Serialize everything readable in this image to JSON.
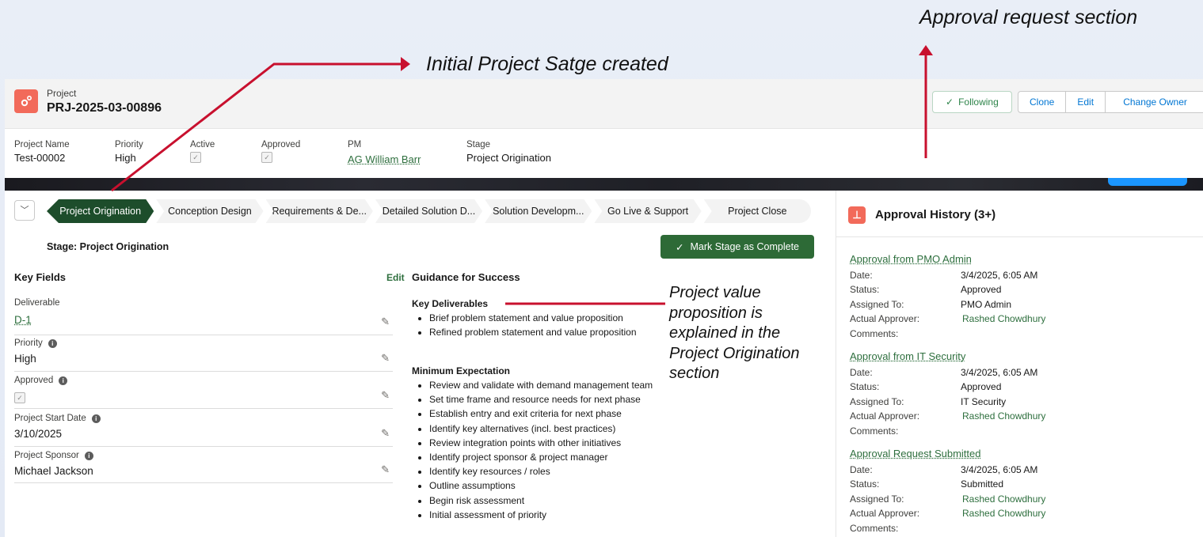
{
  "annotations": {
    "approval_request": "Approval request section",
    "initial_stage": "Initial Project Satge created",
    "value_prop": "Project value proposition is explained in the Project Origination section"
  },
  "header": {
    "object_label": "Project",
    "record_name": "PRJ-2025-03-00896",
    "actions": [
      "Following",
      "Clone",
      "Edit",
      "Change Owner"
    ]
  },
  "highlights": {
    "project_name_label": "Project Name",
    "project_name": "Test-00002",
    "priority_label": "Priority",
    "priority": "High",
    "active_label": "Active",
    "approved_label": "Approved",
    "pm_label": "PM",
    "pm": "AG William Barr",
    "stage_label": "Stage",
    "stage": "Project Origination"
  },
  "path": {
    "steps": [
      "Project Origination",
      "Conception Design",
      "Requirements & De...",
      "Detailed Solution D...",
      "Solution Developm...",
      "Go Live & Support",
      "Project Close"
    ],
    "stage_title": "Stage: Project Origination",
    "mark_complete": "Mark Stage as Complete"
  },
  "key_fields": {
    "title": "Key Fields",
    "edit": "Edit",
    "deliverable_label": "Deliverable",
    "deliverable": "D-1",
    "priority_label": "Priority",
    "priority": "High",
    "approved_label": "Approved",
    "start_label": "Project Start Date",
    "start": "3/10/2025",
    "sponsor_label": "Project Sponsor",
    "sponsor": "Michael Jackson"
  },
  "guidance": {
    "title": "Guidance for Success",
    "kd_title": "Key Deliverables",
    "kd": [
      "Brief problem statement and value proposition",
      "Refined problem statement and value proposition"
    ],
    "me_title": "Minimum Expectation",
    "me": [
      "Review and validate with demand management team",
      "Set time frame and resource needs for next phase",
      "Establish entry and exit criteria for next phase",
      "Identify key alternatives (incl. best practices)",
      "Review integration points with other initiatives",
      "Identify project sponsor & project manager",
      "Identify key resources / roles",
      "Outline assumptions",
      "Begin risk assessment",
      "Initial assessment of priority"
    ]
  },
  "approval_history": {
    "title": "Approval History (3+)",
    "labels": {
      "date": "Date:",
      "status": "Status:",
      "assigned": "Assigned To:",
      "actual": "Actual Approver:",
      "comments": "Comments:"
    },
    "items": [
      {
        "title": "Approval from PMO Admin",
        "date": "3/4/2025, 6:05 AM",
        "status": "Approved",
        "assigned": "PMO Admin",
        "actual": "Rashed Chowdhury"
      },
      {
        "title": "Approval from IT Security",
        "date": "3/4/2025, 6:05 AM",
        "status": "Approved",
        "assigned": "IT Security",
        "actual": "Rashed Chowdhury"
      },
      {
        "title": "Approval Request Submitted",
        "date": "3/4/2025, 6:05 AM",
        "status": "Submitted",
        "assigned": "Rashed Chowdhury",
        "actual": "Rashed Chowdhury"
      }
    ]
  },
  "colors": {
    "accent_red": "#c8102e",
    "active_step": "#1d4d2b",
    "brand_icon": "#f26a5a"
  }
}
